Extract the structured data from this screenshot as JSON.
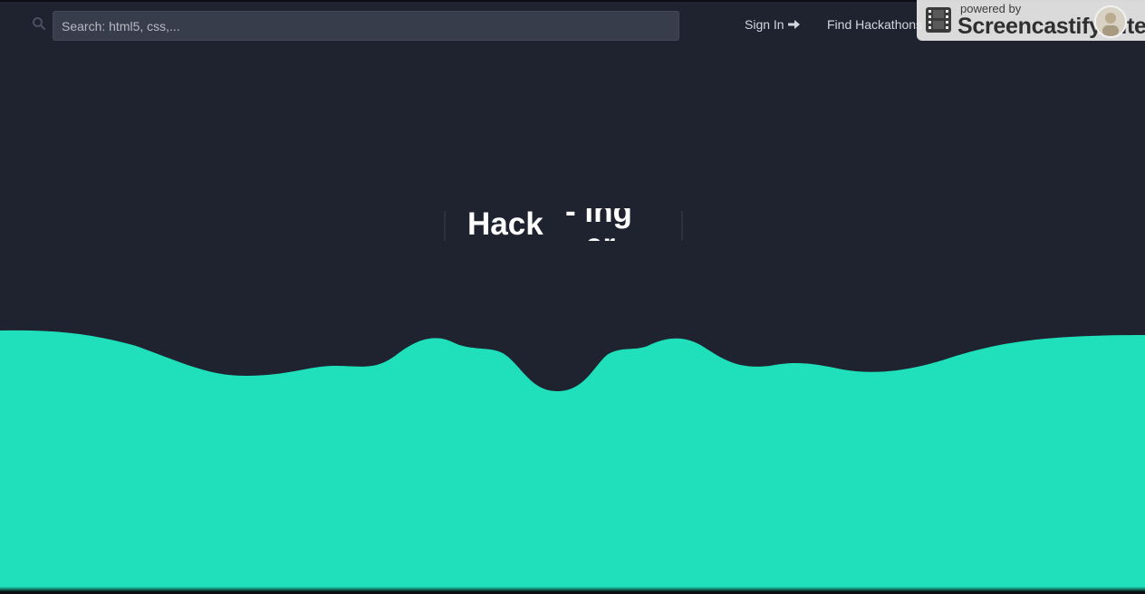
{
  "nav": {
    "search_placeholder": "Search: html5, css,...",
    "sign_in_label": "Sign In",
    "find_hackathons_label": "Find Hackathons"
  },
  "hero": {
    "word": "Hack",
    "rotating_word_1": "- ing",
    "rotating_word_2": "er"
  },
  "overlay": {
    "powered_by": "powered by",
    "brand": "Screencastify Lite"
  },
  "colors": {
    "background": "#1f2330",
    "wave": "#1fe0bb",
    "search_bg": "#383d4b"
  },
  "icons": [
    "search-icon",
    "arrow-right-icon",
    "film-icon",
    "avatar"
  ]
}
